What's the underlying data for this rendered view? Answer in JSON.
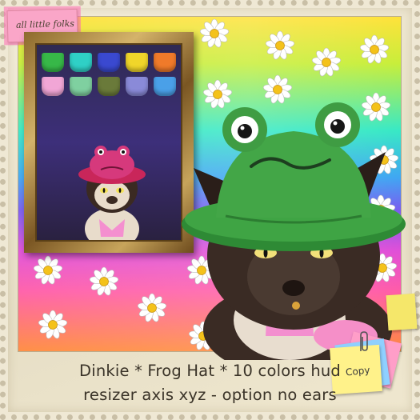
{
  "brand": {
    "tag": "all little folks"
  },
  "caption": {
    "line1": "Dinkie * Frog Hat * 10 colors hud",
    "line2": "resizer axis xyz - option no ears"
  },
  "sticky": {
    "label": "Copy"
  },
  "hud": {
    "swatch_colors": [
      "#37b848",
      "#2fd0c6",
      "#3a49d0",
      "#f0d62a",
      "#f07a2a",
      "#f1a6d6",
      "#7fd0a0",
      "#6a7a3a",
      "#8a8ad8",
      "#4aa0e8"
    ]
  }
}
